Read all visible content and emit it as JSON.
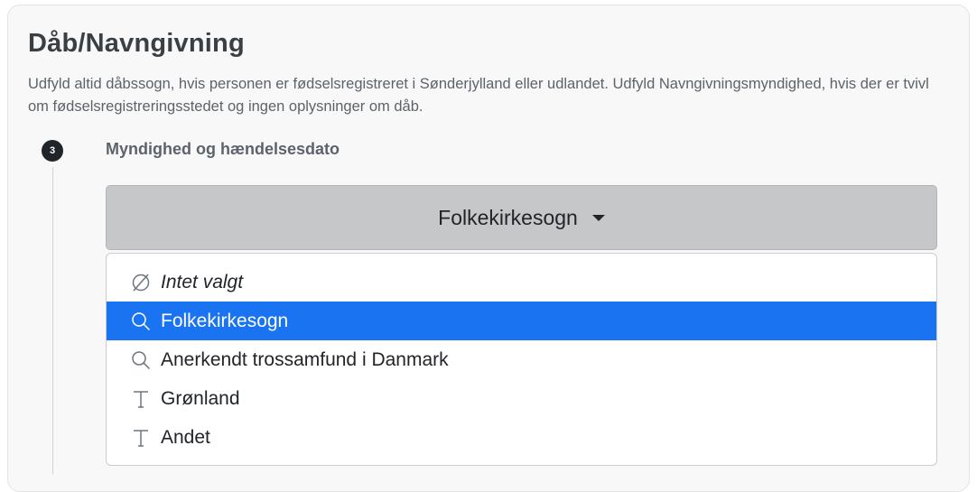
{
  "section": {
    "title": "Dåb/Navngivning",
    "description": "Udfyld altid dåbssogn, hvis personen er fødselsregistreret i Sønderjylland eller udlandet. Udfyld Navngivningsmyndighed, hvis der er tvivl om fødselsregistreringsstedet og ingen oplysninger om dåb."
  },
  "step": {
    "number": "3",
    "label": "Myndighed og hændelsesdato"
  },
  "dropdown": {
    "selected": "Folkekirkesogn",
    "options": [
      {
        "label": "Intet valgt",
        "icon": "empty-set-icon",
        "italic": true,
        "active": false
      },
      {
        "label": "Folkekirkesogn",
        "icon": "search-icon",
        "italic": false,
        "active": true
      },
      {
        "label": "Anerkendt trossamfund i Danmark",
        "icon": "search-icon",
        "italic": false,
        "active": false
      },
      {
        "label": "Grønland",
        "icon": "text-icon",
        "italic": false,
        "active": false
      },
      {
        "label": "Andet",
        "icon": "text-icon",
        "italic": false,
        "active": false
      }
    ]
  },
  "colors": {
    "active_item": "#1a73f0",
    "button_bg": "#c6c7c9",
    "badge_bg": "#212529"
  }
}
